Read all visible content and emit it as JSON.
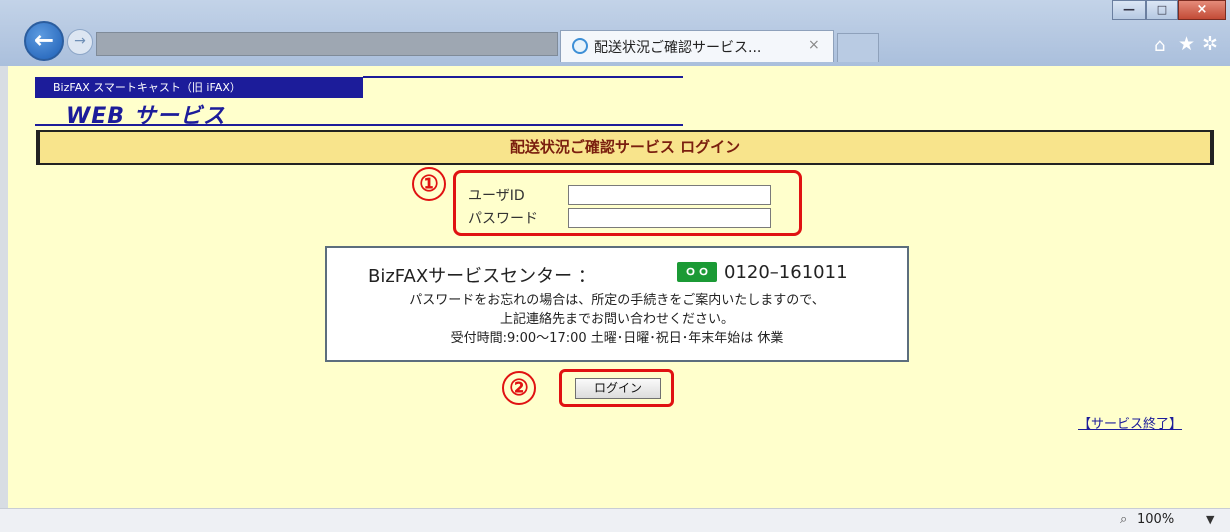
{
  "browser": {
    "back_icon": "←",
    "forward_icon": "→",
    "tab_title": "配送状況ご確認サービス...",
    "tab_close": "×",
    "min_icon": "—",
    "max_icon": "□",
    "close_icon": "×",
    "home_icon": "⌂",
    "star_icon": "★",
    "gear_icon": "✲",
    "zoom": "100%",
    "zoom_icon": "⌕",
    "zoom_arrow": "▼"
  },
  "page": {
    "brand_small": "BizFAX スマートキャスト（旧 iFAX）",
    "brand_web": "WEB サービス",
    "banner": "配送状況ご確認サービス ログイン",
    "annotation_1": "①",
    "annotation_2": "②",
    "user_label": "ユーザID",
    "pass_label": "パスワード",
    "info_center": "BizFAXサービスセンター ：",
    "free_dial_icon": "ｏｏ",
    "phone": "0120–161011",
    "info_line2": "パスワードをお忘れの場合は、所定の手続きをご案内いたしますので、",
    "info_line3": "上記連絡先までお問い合わせください。",
    "info_line4": "受付時間:9:00～17:00 土曜･日曜･祝日･年末年始は 休業",
    "login_button": "ログイン",
    "end_link": "【サービス終了】"
  },
  "colors": {
    "page_bg": "#ffffcc",
    "brand_navy": "#1c1c9a",
    "banner_bg": "#f8e48c",
    "banner_text": "#7a1e0e",
    "annotation_red": "#e01212"
  }
}
